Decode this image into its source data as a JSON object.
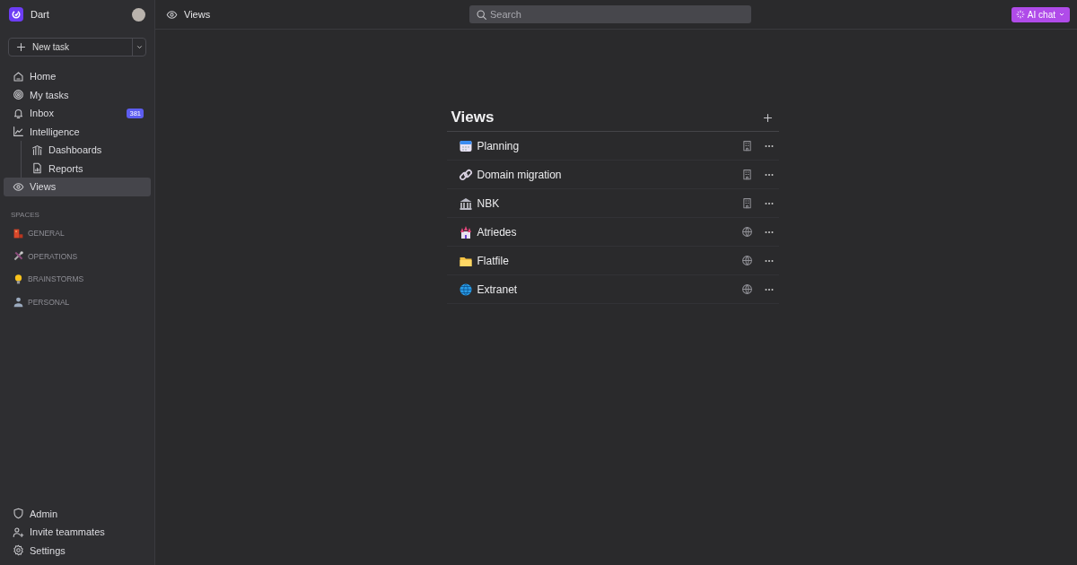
{
  "workspace": {
    "name": "Dart"
  },
  "new_task": {
    "label": "New task"
  },
  "nav": [
    {
      "label": "Home",
      "selected": false
    },
    {
      "label": "My tasks",
      "selected": false
    },
    {
      "label": "Inbox",
      "selected": false,
      "badge": "381"
    },
    {
      "label": "Intelligence",
      "selected": false,
      "children": [
        {
          "label": "Dashboards",
          "selected": false
        },
        {
          "label": "Reports",
          "selected": false
        }
      ]
    },
    {
      "label": "Views",
      "selected": true
    }
  ],
  "spaces": {
    "heading": "SPACES",
    "items": [
      {
        "label": "GENERAL"
      },
      {
        "label": "OPERATIONS"
      },
      {
        "label": "BRAINSTORMS"
      },
      {
        "label": "PERSONAL"
      }
    ]
  },
  "footer": [
    {
      "label": "Admin"
    },
    {
      "label": "Invite teammates"
    },
    {
      "label": "Settings"
    }
  ],
  "topbar": {
    "title": "Views",
    "search": {
      "placeholder": "Search"
    },
    "ai_button": "AI chat"
  },
  "views": {
    "title": "Views",
    "items": [
      {
        "label": "Planning",
        "public": false
      },
      {
        "label": "Domain migration",
        "public": false
      },
      {
        "label": "NBK",
        "public": false
      },
      {
        "label": "Atriedes",
        "public": true
      },
      {
        "label": "Flatfile",
        "public": true
      },
      {
        "label": "Extranet",
        "public": true
      }
    ]
  }
}
